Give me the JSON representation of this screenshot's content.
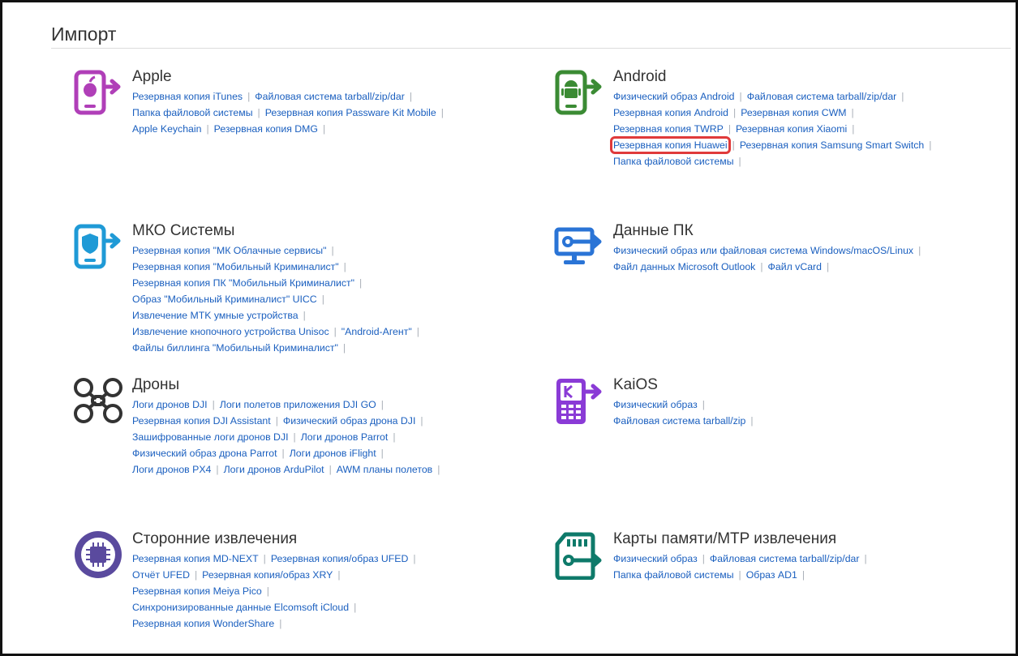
{
  "page": {
    "title": "Импорт"
  },
  "sections": {
    "apple": {
      "title": "Apple",
      "icon": "apple-phone-import-icon",
      "rows": [
        [
          "Резервная копия iTunes",
          "Файловая система tarball/zip/dar"
        ],
        [
          "Папка файловой системы",
          "Резервная копия Passware Kit Mobile"
        ],
        [
          "Apple Keychain",
          "Резервная копия DMG"
        ]
      ]
    },
    "android": {
      "title": "Android",
      "icon": "android-phone-import-icon",
      "highlighted": "Резервная копия Huawei",
      "rows": [
        [
          "Физический образ Android",
          "Файловая система tarball/zip/dar"
        ],
        [
          "Резервная копия Android",
          "Резервная копия CWM"
        ],
        [
          "Резервная копия TWRP",
          "Резервная копия Xiaomi"
        ],
        [
          "Резервная копия Huawei",
          "Резервная копия Samsung Smart Switch"
        ],
        [
          "Папка файловой системы"
        ]
      ]
    },
    "mko": {
      "title": "МКО Системы",
      "icon": "shield-phone-import-icon",
      "rows": [
        [
          "Резервная копия \"МК Облачные сервисы\""
        ],
        [
          "Резервная копия \"Мобильный Криминалист\""
        ],
        [
          "Резервная копия ПК \"Мобильный Криминалист\""
        ],
        [
          "Образ \"Мобильный Криминалист\" UICC"
        ],
        [
          "Извлечение MTK умные устройства"
        ],
        [
          "Извлечение кнопочного устройства Unisoc",
          "\"Android-Агент\""
        ],
        [
          "Файлы биллинга \"Мобильный Криминалист\""
        ]
      ]
    },
    "pc": {
      "title": "Данные ПК",
      "icon": "pc-monitor-key-icon",
      "rows": [
        [
          "Физический образ или файловая система Windows/macOS/Linux"
        ],
        [
          "Файл данных Microsoft Outlook",
          "Файл vCard"
        ]
      ]
    },
    "drones": {
      "title": "Дроны",
      "icon": "drone-icon",
      "rows": [
        [
          "Логи дронов DJI",
          "Логи полетов приложения DJI GO"
        ],
        [
          "Резервная копия DJI Assistant",
          "Физический образ дрона DJI"
        ],
        [
          "Зашифрованные логи дронов DJI",
          "Логи дронов Parrot"
        ],
        [
          "Физический образ дрона Parrot",
          "Логи дронов iFlight"
        ],
        [
          "Логи дронов PX4",
          "Логи дронов ArduPilot",
          "AWM планы полетов"
        ]
      ]
    },
    "kaios": {
      "title": "KaiOS",
      "icon": "kaios-phone-import-icon",
      "rows": [
        [
          "Физический образ"
        ],
        [
          "Файловая система tarball/zip"
        ]
      ]
    },
    "thirdparty": {
      "title": "Сторонние извлечения",
      "icon": "chip-circle-icon",
      "rows": [
        [
          "Резервная копия MD-NEXT",
          "Резервная копия/образ UFED"
        ],
        [
          "Отчёт UFED",
          "Резервная копия/образ XRY"
        ],
        [
          "Резервная копия Meiya Pico"
        ],
        [
          "Синхронизированные данные Elcomsoft iCloud"
        ],
        [
          "Резервная копия WonderShare"
        ]
      ]
    },
    "memcards": {
      "title": "Карты памяти/MTP извлечения",
      "icon": "memory-card-key-icon",
      "rows": [
        [
          "Физический образ",
          "Файловая система tarball/zip/dar"
        ],
        [
          "Папка файловой системы",
          "Образ AD1"
        ]
      ]
    }
  },
  "colors": {
    "apple": "#b03fb8",
    "android": "#3b8b34",
    "mko": "#1f9ad6",
    "pc": "#2a74d6",
    "drones": "#333333",
    "kaios": "#8a3bd6",
    "thirdparty": "#5a4a9e",
    "memcards": "#0e7a6a",
    "link": "#1a5fbf",
    "highlight": "#e03a3a"
  }
}
